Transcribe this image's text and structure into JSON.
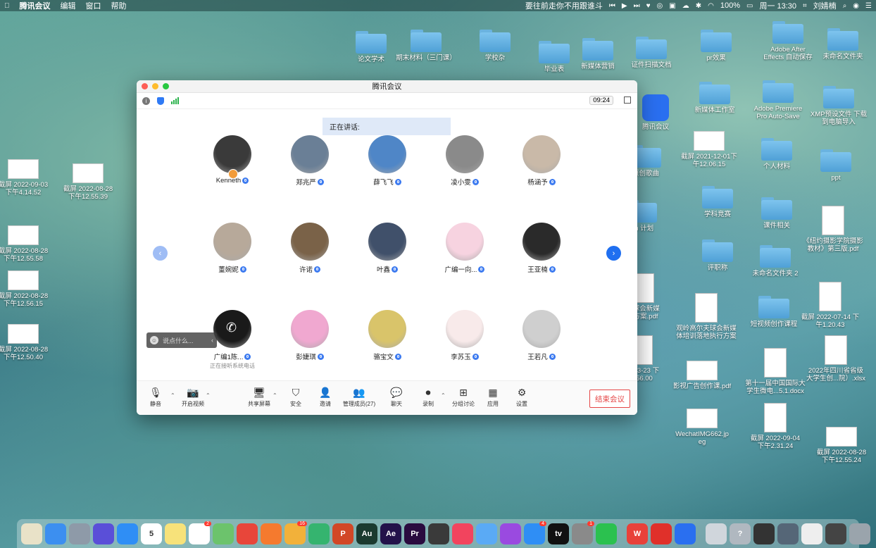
{
  "menubar": {
    "app": "腾讯会议",
    "menus": [
      "编辑",
      "窗口",
      "帮助"
    ],
    "now_playing": "要往前走你不用跟谁斗",
    "battery": "100%",
    "datetime": "周一 13:30",
    "user": "刘婧楠"
  },
  "desktop": {
    "items": [
      {
        "label": "论文学术",
        "kind": "folder"
      },
      {
        "label": "期末材料（三门课）",
        "kind": "folder"
      },
      {
        "label": "学校杂",
        "kind": "folder"
      },
      {
        "label": "毕业表",
        "kind": "folder"
      },
      {
        "label": "新媒体营销",
        "kind": "folder"
      },
      {
        "label": "证件扫描文档",
        "kind": "folder"
      },
      {
        "label": "pr效果",
        "kind": "folder"
      },
      {
        "label": "Adobe After\nEffects 自动保存",
        "kind": "folder"
      },
      {
        "label": "未命名文件夹",
        "kind": "folder"
      },
      {
        "label": "腾讯会议",
        "kind": "app"
      },
      {
        "label": "新媒体工作室",
        "kind": "folder"
      },
      {
        "label": "Adobe Premiere\nPro Auto-Save",
        "kind": "folder"
      },
      {
        "label": "XMP预设文件 下载\n到电脑导入",
        "kind": "folder"
      },
      {
        "label": "截屏 2021-12-01下\n午12.06.15",
        "kind": "thumb"
      },
      {
        "label": "原创歌曲",
        "kind": "folder"
      },
      {
        "label": "个人材料",
        "kind": "folder"
      },
      {
        "label": "ppt",
        "kind": "folder"
      },
      {
        "label": "学科竞赛",
        "kind": "folder"
      },
      {
        "label": "cm 计划",
        "kind": "folder"
      },
      {
        "label": "课件相关",
        "kind": "folder"
      },
      {
        "label": "《纽约摄影学院摄影\n教材》第三版.pdf",
        "kind": "doc"
      },
      {
        "label": "评职称",
        "kind": "folder"
      },
      {
        "label": "未命名文件夹 2",
        "kind": "folder"
      },
      {
        "label": "夫球会新媒\n...方案.pdf",
        "kind": "doc"
      },
      {
        "label": "观岭高尔夫球会新媒\n体培训落地执行方案",
        "kind": "doc"
      },
      {
        "label": "短视频创作课程",
        "kind": "folder"
      },
      {
        "label": "截屏 2022-07-14 下\n午1.20.43",
        "kind": "doc"
      },
      {
        "label": "22-03-23 下\n1.56.00",
        "kind": "doc"
      },
      {
        "label": "影视广告创作课.pdf",
        "kind": "thumb"
      },
      {
        "label": "第十一届中国国际大\n学生微电...5.1.docx",
        "kind": "doc"
      },
      {
        "label": "2022年四川省省级\n大学生创...院）.xlsx",
        "kind": "doc"
      },
      {
        "label": "WechatIMG662.jp\neg",
        "kind": "thumb"
      },
      {
        "label": "截屏 2022-09-04\n下午2.31.24",
        "kind": "doc"
      },
      {
        "label": "截屏 2022-08-28\n下午12.55.24",
        "kind": "thumb"
      },
      {
        "label": "截屏 2022-09-03\n下午4.14.52",
        "kind": "thumb"
      },
      {
        "label": "截屏 2022-08-28\n下午12.55.39",
        "kind": "thumb"
      },
      {
        "label": "截屏 2022-08-28\n下午12.55.58",
        "kind": "thumb"
      },
      {
        "label": "截屏 2022-08-28\n下午12.56.15",
        "kind": "thumb"
      },
      {
        "label": "截屏 2022-08-28\n下午12.50.40",
        "kind": "thumb"
      }
    ]
  },
  "meeting": {
    "window_title": "腾讯会议",
    "timer": "09:24",
    "speaking_label": "正在讲话:",
    "chat_placeholder": "说点什么...",
    "participants": [
      {
        "name": "Kenneth",
        "color": "#3a3a3a"
      },
      {
        "name": "郑兆严",
        "color": "#6a7f96"
      },
      {
        "name": "薛飞飞",
        "color": "#4f86c7"
      },
      {
        "name": "凌小雯",
        "color": "#8a8a8a"
      },
      {
        "name": "杨涵予",
        "color": "#c9b9a8"
      },
      {
        "name": "董婉妮",
        "color": "#b7a99a"
      },
      {
        "name": "许诺",
        "color": "#7a6248"
      },
      {
        "name": "叶鑫",
        "color": "#40506a"
      },
      {
        "name": "广编一向...",
        "color": "#f7d3e0"
      },
      {
        "name": "王亚楠",
        "color": "#2a2a2a"
      },
      {
        "name": "广编1陈...",
        "color": "#1a1a1a",
        "sub": "正在接听系统电话"
      },
      {
        "name": "彭婕琪",
        "color": "#f0a8d0"
      },
      {
        "name": "骆宝文",
        "color": "#d9c46a"
      },
      {
        "name": "李苏玉",
        "color": "#f8eaea"
      },
      {
        "name": "王若凡",
        "color": "#cfcfcf"
      }
    ],
    "toolbar": {
      "mute": "静音",
      "video": "开启视频",
      "share": "共享屏幕",
      "security": "安全",
      "invite": "邀请",
      "members": "管理成员(27)",
      "chat": "聊天",
      "record": "录制",
      "breakout": "分组讨论",
      "apps": "应用",
      "settings": "设置",
      "end": "结束会议"
    }
  },
  "dock": {
    "apps": [
      {
        "name": "notes-doc",
        "color": "#e9e2c8",
        "text": ""
      },
      {
        "name": "finder",
        "color": "#3c8ff0",
        "text": ""
      },
      {
        "name": "launchpad",
        "color": "#8e9aa8",
        "text": ""
      },
      {
        "name": "siri",
        "color": "#5a4fd8",
        "text": ""
      },
      {
        "name": "safari",
        "color": "#2f8ef5",
        "text": ""
      },
      {
        "name": "calendar",
        "color": "#ffffff",
        "text": "5"
      },
      {
        "name": "notes",
        "color": "#f7e27a",
        "text": ""
      },
      {
        "name": "reminders",
        "color": "#ffffff",
        "text": "",
        "badge": "2"
      },
      {
        "name": "maps",
        "color": "#6cc36c",
        "text": ""
      },
      {
        "name": "xmind",
        "color": "#e8463a",
        "text": ""
      },
      {
        "name": "firefox",
        "color": "#f57a2e",
        "text": ""
      },
      {
        "name": "photos",
        "color": "#f2b13a",
        "text": "",
        "badge": "16"
      },
      {
        "name": "infuse",
        "color": "#35b46f",
        "text": ""
      },
      {
        "name": "powerpoint",
        "color": "#d24726",
        "text": "P"
      },
      {
        "name": "audition",
        "color": "#1b3a2f",
        "text": "Au"
      },
      {
        "name": "after-effects",
        "color": "#23124a",
        "text": "Ae"
      },
      {
        "name": "premiere",
        "color": "#2a0b3f",
        "text": "Pr"
      },
      {
        "name": "final-cut",
        "color": "#3a3a3a",
        "text": ""
      },
      {
        "name": "music",
        "color": "#f2445e",
        "text": ""
      },
      {
        "name": "icloud",
        "color": "#5aaaf5",
        "text": ""
      },
      {
        "name": "podcasts",
        "color": "#9a4ae0",
        "text": ""
      },
      {
        "name": "app-store",
        "color": "#2f8ef5",
        "text": "",
        "badge": "4"
      },
      {
        "name": "apple-tv",
        "color": "#111111",
        "text": "tv"
      },
      {
        "name": "system-preferences",
        "color": "#8a8a8a",
        "text": "",
        "badge": "1"
      },
      {
        "name": "wechat",
        "color": "#2bc14f",
        "text": ""
      },
      {
        "name": "wps",
        "color": "#e8413a",
        "text": "W"
      },
      {
        "name": "netease-music",
        "color": "#e0302a",
        "text": ""
      },
      {
        "name": "tencent-meeting",
        "color": "#2a6ff0",
        "text": ""
      },
      {
        "name": "preview",
        "color": "#d0d6dc",
        "text": ""
      },
      {
        "name": "help",
        "color": "#b0b8c0",
        "text": "?"
      },
      {
        "name": "screen-thumb-1",
        "color": "#333333",
        "text": ""
      },
      {
        "name": "screen-thumb-2",
        "color": "#556677",
        "text": ""
      },
      {
        "name": "doc-thumb",
        "color": "#eeeeee",
        "text": ""
      },
      {
        "name": "screen-thumb-3",
        "color": "#444444",
        "text": ""
      },
      {
        "name": "trash",
        "color": "#9aa4ac",
        "text": ""
      }
    ]
  }
}
